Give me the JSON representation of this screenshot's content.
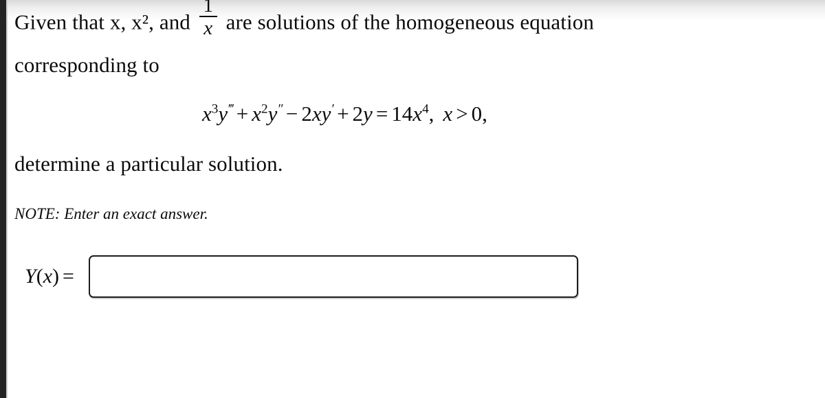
{
  "problem": {
    "line_1": {
      "before_fraction": "Given that x, x², and",
      "fraction_numerator": "1",
      "fraction_denominator": "x",
      "after_fraction": "are solutions of the homogeneous equation"
    },
    "line_2": "corresponding to",
    "line_3": "determine a particular solution.",
    "note": "NOTE: Enter an exact answer."
  },
  "equation": {
    "full_text": "x³y‴ + x²y″ − 2xy′ + 2y = 14x⁴,  x > 0,",
    "terms": {
      "t1_base": "x",
      "t1_exp": "3",
      "t1_func": "y",
      "t1_primes": "‴",
      "op1": "+",
      "t2_base": "x",
      "t2_exp": "2",
      "t2_func": "y",
      "t2_primes": "″",
      "op2": "−",
      "t3_coeff": "2",
      "t3_base": "x",
      "t3_func": "y",
      "t3_primes": "′",
      "op3": "+",
      "t4_coeff": "2",
      "t4_func": "y",
      "equals": "=",
      "rhs_coeff": "14",
      "rhs_base": "x",
      "rhs_exp": "4",
      "rhs_comma": ",",
      "domain_var": "x",
      "domain_op": ">",
      "domain_value": "0",
      "trailing_comma": ","
    }
  },
  "answer": {
    "label_func": "Y",
    "label_open": "(",
    "label_var": "x",
    "label_close": ")",
    "label_equals": "=",
    "value": "",
    "placeholder": ""
  },
  "colors": {
    "text": "#0b0b0b",
    "background": "#ffffff",
    "left_strip": "#242424",
    "input_border": "#1c1c1c"
  }
}
